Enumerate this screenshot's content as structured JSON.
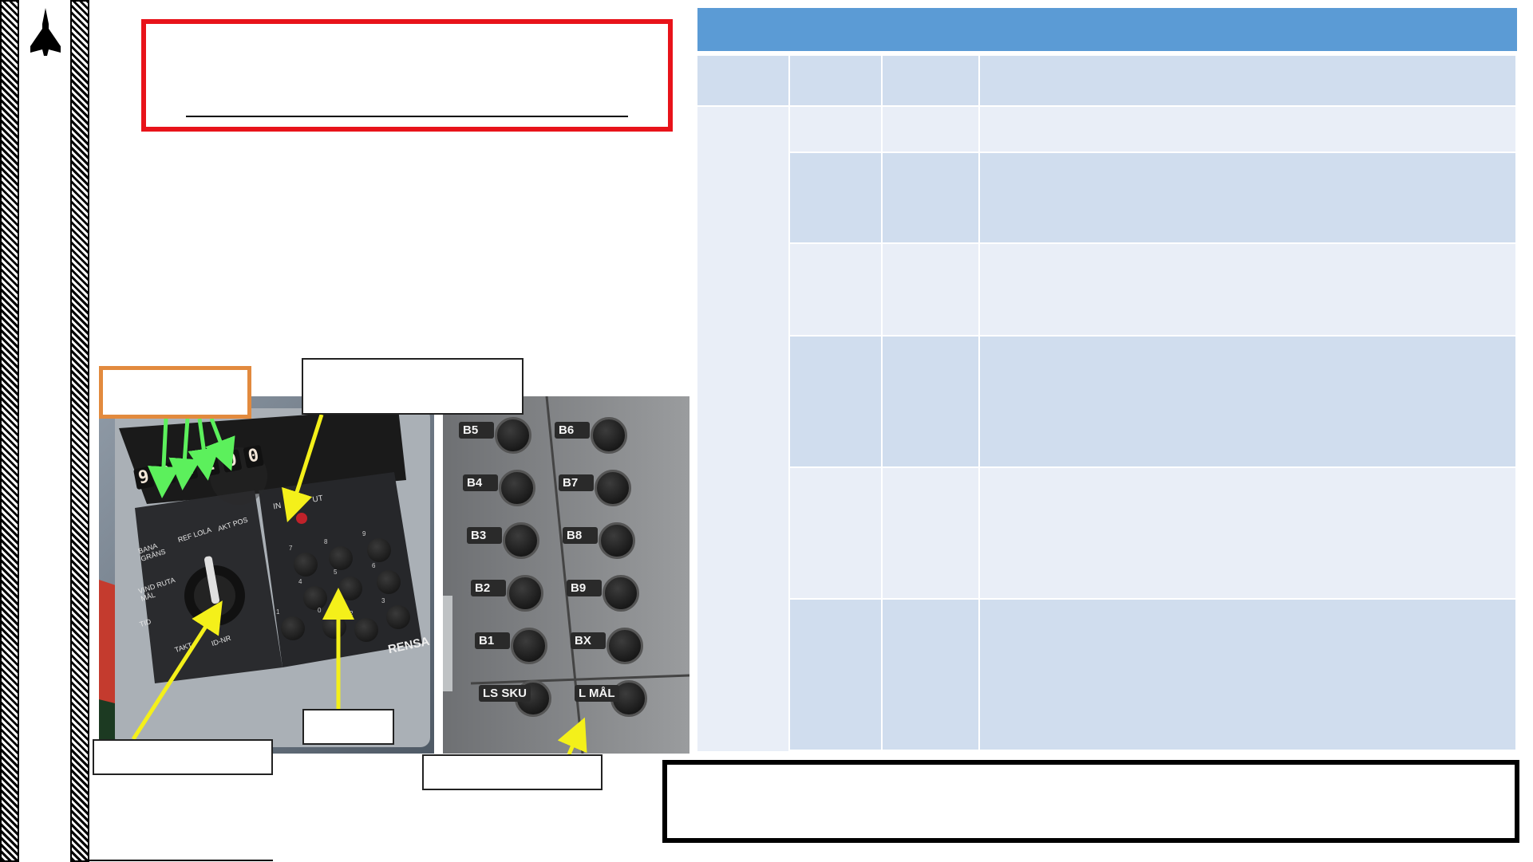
{
  "sidebar": {
    "logo_icon": "jet-aircraft-icon"
  },
  "title_box": {
    "title": "",
    "subtitle": ""
  },
  "panel_left": {
    "name": "navigation-data-panel",
    "counter_digits": [
      "9",
      "0",
      "1",
      "2",
      "0",
      "0"
    ],
    "switch_labels": [
      "IN",
      "UT"
    ],
    "selector_labels": [
      "BANA GRÄNS",
      "REF LOLA",
      "AKT POS",
      "VIND RUTA MÅL",
      "TID",
      "TAKT",
      "ID-NR"
    ],
    "keypad_keys": [
      "1",
      "2",
      "3",
      "4",
      "5",
      "6",
      "7",
      "8",
      "9",
      "0"
    ],
    "clear_label": "RENSA"
  },
  "panel_right": {
    "name": "waypoint-button-panel",
    "left_column": [
      "B5",
      "B4",
      "B3",
      "B2",
      "B1",
      "LS SKU"
    ],
    "right_column": [
      "B6",
      "B7",
      "B8",
      "B9",
      "BX",
      "L MÅL"
    ]
  },
  "callouts": {
    "counter_callout": "",
    "indicator_callout": "",
    "selector_callout": "",
    "keypad_callout": "",
    "button_callout": ""
  },
  "table": {
    "header": "",
    "columns": [
      "",
      "",
      "",
      ""
    ],
    "rows": [
      [
        "",
        "",
        ""
      ],
      [
        "",
        "",
        ""
      ],
      [
        "",
        "",
        ""
      ],
      [
        "",
        "",
        ""
      ],
      [
        "",
        "",
        ""
      ],
      [
        "",
        "",
        ""
      ]
    ]
  },
  "note_box": {
    "text": ""
  },
  "colors": {
    "title_border": "#e8131a",
    "table_header": "#5b9bd5",
    "table_dark": "#d0ddee",
    "table_light": "#e9eef7",
    "orange_callout": "#e28a3e",
    "green_arrow": "#5cf05c",
    "yellow_arrow": "#f4f01a"
  }
}
